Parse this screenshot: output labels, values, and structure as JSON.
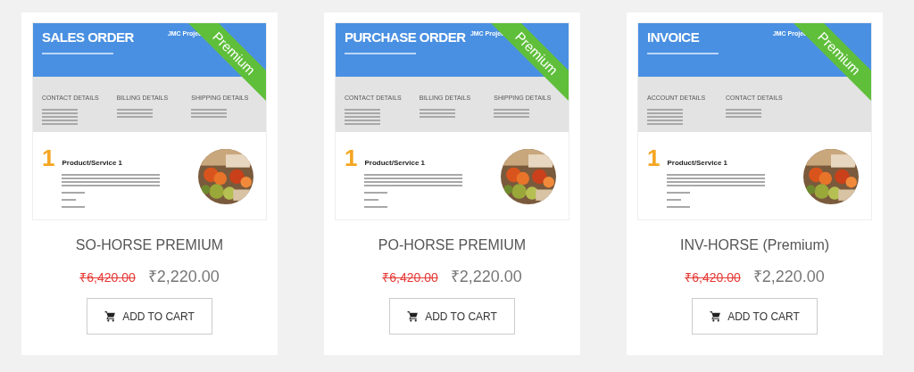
{
  "products": [
    {
      "preview": {
        "title": "SALES ORDER",
        "company": "JMC Projec",
        "sections": [
          "CONTACT DETAILS",
          "BILLING DETAILS",
          "SHIPPING DETAILS"
        ],
        "item_number": "1",
        "item_title": "Product/Service 1"
      },
      "ribbon": "Premium",
      "name": "SO-HORSE PREMIUM",
      "old_price": "₹6,420.00",
      "price": "₹2,220.00",
      "button": "ADD TO CART"
    },
    {
      "preview": {
        "title": "PURCHASE ORDER",
        "company": "JMC Projec",
        "sections": [
          "CONTACT DETAILS",
          "BILLING DETAILS",
          "SHIPPING DETAILS"
        ],
        "item_number": "1",
        "item_title": "Product/Service 1"
      },
      "ribbon": "Premium",
      "name": "PO-HORSE PREMIUM",
      "old_price": "₹6,420.00",
      "price": "₹2,220.00",
      "button": "ADD TO CART"
    },
    {
      "preview": {
        "title": "INVOICE",
        "company": "JMC Projec",
        "sections": [
          "ACCOUNT DETAILS",
          "CONTACT DETAILS"
        ],
        "item_number": "1",
        "item_title": "Product/Service 1"
      },
      "ribbon": "Premium",
      "name": "INV-HORSE (Premium)",
      "old_price": "₹6,420.00",
      "price": "₹2,220.00",
      "button": "ADD TO CART"
    }
  ]
}
